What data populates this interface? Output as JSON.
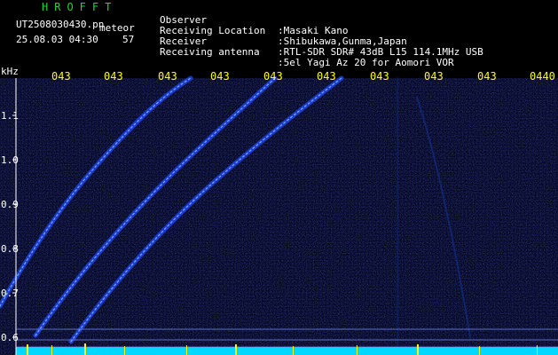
{
  "header": {
    "app_title": "HROFFT",
    "file_name": "UT2508030430.pn",
    "mode_label": "meteor",
    "datetime": "25.08.03 04:30",
    "count": "57"
  },
  "info": [
    {
      "key": "Observer",
      "value": ":Masaki Kano"
    },
    {
      "key": "Receiving Location",
      "value": ":Shibukawa,Gunma,Japan"
    },
    {
      "key": "Receiver",
      "value": ":RTL-SDR SDR# 43dB L15 114.1MHz USB"
    },
    {
      "key": "Receiving antenna",
      "value": ":5el Yagi Az 20 for Aomori VOR"
    }
  ],
  "axis": {
    "y_unit": "kHz",
    "y_ticks": [
      "1.1",
      "1.0",
      "0.9",
      "0.8",
      "0.7",
      "0.6"
    ],
    "x_ticks": [
      "043",
      "043",
      "043",
      "043",
      "043",
      "043",
      "043",
      "043",
      "043",
      "0440"
    ]
  },
  "colors": {
    "background": "#000000",
    "signal": "#1e4cff",
    "signal_bright": "#8fb0ff",
    "baseline": "#00d8ff",
    "tick_text": "#ffff00",
    "title": "#1fd63c"
  }
}
